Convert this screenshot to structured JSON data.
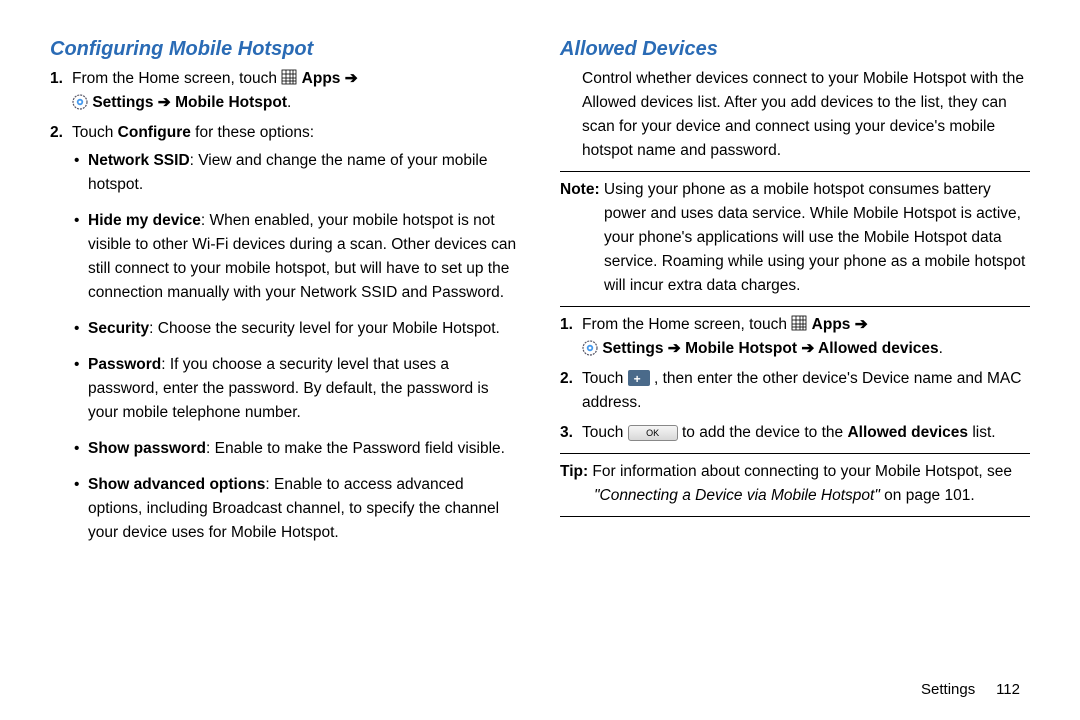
{
  "left": {
    "heading": "Configuring Mobile Hotspot",
    "step1_a": "From the Home screen, touch ",
    "apps_label": "Apps",
    "step1_b": "Settings",
    "step1_c": "Mobile Hotspot",
    "step2_a": "Touch ",
    "step2_b": "Configure",
    "step2_c": " for these options:",
    "bullets": {
      "b1_bold": "Network SSID",
      "b1_rest": ": View and change the name of your mobile hotspot.",
      "b2_bold": "Hide my device",
      "b2_rest": ": When enabled, your mobile hotspot is not visible to other Wi-Fi devices during a scan. Other devices can still connect to your mobile hotspot, but will have to set up the connection manually with your Network SSID and Password.",
      "b3_bold": "Security",
      "b3_rest": ": Choose the security level for your Mobile Hotspot.",
      "b4_bold": "Password",
      "b4_rest": ": If you choose a security level that uses a password, enter the password. By default, the password is your mobile telephone number.",
      "b5_bold": "Show password",
      "b5_rest": ": Enable to make the Password field visible.",
      "b6_bold": "Show advanced options",
      "b6_rest": ": Enable to access advanced options, including Broadcast channel, to specify the channel your device uses for Mobile Hotspot."
    }
  },
  "right": {
    "heading": "Allowed Devices",
    "intro": "Control whether devices connect to your Mobile Hotspot with the Allowed devices list. After you add devices to the list, they can scan for your device and connect using your device's mobile hotspot name and password.",
    "note_label": "Note:",
    "note_text": " Using your phone as a mobile hotspot consumes battery power and uses data service. While Mobile Hotspot is active, your phone's applications will use the Mobile Hotspot data service. Roaming while using your phone as a mobile hotspot will incur extra data charges.",
    "step1_a": "From the Home screen, touch ",
    "apps_label": "Apps",
    "step1_b": "Settings",
    "step1_c": "Mobile Hotspot",
    "step1_d": "Allowed devices",
    "step2_a": "Touch ",
    "step2_b": ", then enter the other device's Device name and MAC address.",
    "step3_a": "Touch ",
    "ok_label": "OK",
    "step3_b": " to add the device to the ",
    "step3_c": "Allowed devices",
    "step3_d": " list.",
    "tip_label": "Tip:",
    "tip_a": " For information about connecting to your Mobile Hotspot, see ",
    "tip_ref": "\"Connecting a Device via Mobile Hotspot\"",
    "tip_b": " on page 101."
  },
  "footer": {
    "section": "Settings",
    "page": "112"
  },
  "arrow": " ➔ "
}
